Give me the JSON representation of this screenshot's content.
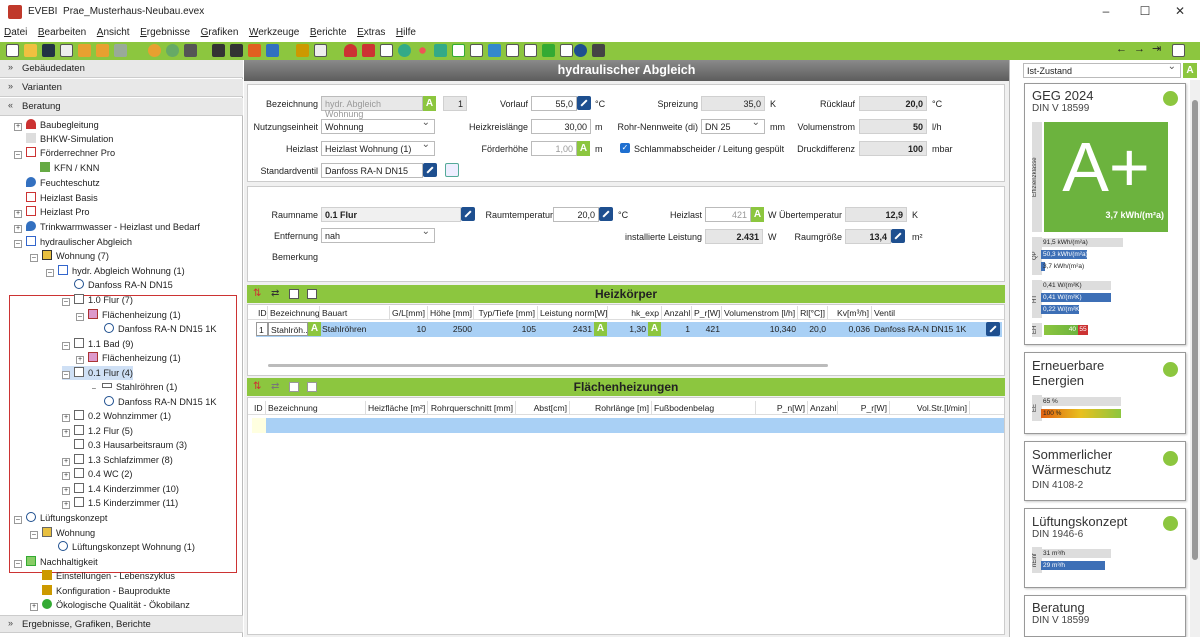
{
  "window": {
    "app": "EVEBI",
    "file": "Prae_Musterhaus-Neubau.evex",
    "minimize": "–",
    "maximize": "☐",
    "close": "✕"
  },
  "menu": [
    "Datei",
    "Bearbeiten",
    "Ansicht",
    "Ergebnisse",
    "Grafiken",
    "Werkzeuge",
    "Berichte",
    "Extras",
    "Hilfe"
  ],
  "left": {
    "sections": [
      "Gebäudedaten",
      "Varianten",
      "Beratung"
    ],
    "bottom_section": "Ergebnisse, Grafiken, Berichte",
    "tree": [
      "Baubegleitung",
      "BHKW-Simulation",
      "Förderrechner Pro",
      "KFN / KNN",
      "Feuchteschutz",
      "Heizlast Basis",
      "Heizlast Pro",
      "Trinkwarmwasser - Heizlast und Bedarf",
      "hydraulischer Abgleich",
      "Wohnung (7)",
      "hydr. Abgleich Wohnung (1)",
      "Danfoss RA-N DN15",
      "1.0 Flur (7)",
      "Flächenheizung (1)",
      "Danfoss RA-N DN15 1K",
      "1.1 Bad (9)",
      "Flächenheizung (1)",
      "0.1 Flur (4)",
      "Stahlröhren (1)",
      "Danfoss RA-N DN15 1K",
      "0.2 Wohnzimmer (1)",
      "1.2 Flur (5)",
      "0.3 Hausarbeitsraum (3)",
      "1.3 Schlafzimmer (8)",
      "0.4 WC (2)",
      "1.4 Kinderzimmer (10)",
      "1.5 Kinderzimmer (11)",
      "Lüftungskonzept",
      "Wohnung",
      "Lüftungskonzept Wohnung (1)",
      "Nachhaltigkeit",
      "Einstellungen - Lebenszyklus",
      "Konfiguration - Bauprodukte",
      "Ökologische Qualität - Ökobilanz"
    ]
  },
  "center": {
    "title": "hydraulischer Abgleich",
    "top": {
      "bezeichnung_label": "Bezeichnung",
      "bezeichnung_value": "hydr. Abgleich Wohnung",
      "bez_num": "1",
      "nutzung_label": "Nutzungseinheit",
      "nutzung_value": "Wohnung",
      "heizlast_label": "Heizlast",
      "heizlast_value": "Heizlast Wohnung (1)",
      "ventil_label": "Standardventil",
      "ventil_value": "Danfoss RA-N DN15",
      "vorlauf_label": "Vorlauf",
      "vorlauf_value": "55,0",
      "vorlauf_unit": "°C",
      "hkl_label": "Heizkreislänge",
      "hkl_value": "30,00",
      "hkl_unit": "m",
      "fh_label": "Förderhöhe",
      "fh_value": "1,00",
      "fh_unit": "m",
      "spreizung_label": "Spreizung",
      "spreizung_value": "35,0",
      "spreizung_unit": "K",
      "rohr_label": "Rohr-Nennweite (di)",
      "rohr_value": "DN 25",
      "rohr_unit": "mm",
      "schlamm_label": "Schlammabscheider / Leitung gespült",
      "ruecklauf_label": "Rücklauf",
      "ruecklauf_value": "20,0",
      "ruecklauf_unit": "°C",
      "vstrom_label": "Volumenstrom",
      "vstrom_value": "50",
      "vstrom_unit": "l/h",
      "druck_label": "Druckdifferenz",
      "druck_value": "100",
      "druck_unit": "mbar"
    },
    "room": {
      "raumname_label": "Raumname",
      "raumname_value": "0.1 Flur",
      "entfernung_label": "Entfernung",
      "entfernung_value": "nah",
      "bemerkung_label": "Bemerkung",
      "raumtemp_label": "Raumtemperatur",
      "raumtemp_value": "20,0",
      "raumtemp_unit": "°C",
      "heizlast_label": "Heizlast",
      "heizlast_value": "421",
      "heizlast_unit": "W",
      "uebertemp_label": "Übertemperatur",
      "uebertemp_value": "12,9",
      "uebertemp_unit": "K",
      "instl_label": "installierte Leistung",
      "instl_value": "2.431",
      "instl_unit": "W",
      "raumgr_label": "Raumgröße",
      "raumgr_value": "13,4",
      "raumgr_unit": "m²"
    },
    "heizkoerper": {
      "title": "Heizkörper",
      "columns": [
        "ID",
        "Bezeichnung",
        "Bauart",
        "G/L[mm]",
        "Höhe [mm]",
        "Typ/Tiefe [mm]",
        "Leistung norm[W]",
        "hk_exp",
        "Anzahl",
        "P_r[W]",
        "Volumenstrom [l/h]",
        "Rl[°C]]",
        "Kv[m³/h]",
        "Ventil"
      ],
      "row": [
        "1",
        "Stahlröh...",
        "Stahlröhren",
        "10",
        "2500",
        "105",
        "2431",
        "1,30",
        "1",
        "421",
        "10,340",
        "20,0",
        "0,036",
        "Danfoss RA-N DN15 1K"
      ]
    },
    "flaechen": {
      "title": "Flächenheizungen",
      "columns": [
        "ID",
        "Bezeichnung",
        "Heizfläche [m²]",
        "Rohrquerschnitt [mm]",
        "Abst[cm]",
        "Rohrlänge [m]",
        "Fußbodenbelag",
        "P_n[W]",
        "Anzahl",
        "P_r[W]",
        "Vol.Str.[l/min]"
      ]
    }
  },
  "right": {
    "dropdown": "Ist-Zustand",
    "geg": {
      "title": "GEG 2024",
      "sub": "DIN V 18599",
      "grade": "A+",
      "value": "3,7 kWh/(m²a)",
      "side": "Effizienzklasse",
      "qp": [
        "91,5 kWh/(m²a)",
        "50,3 kWh/(m²a)",
        "3,7 kWh/(m²a)"
      ],
      "qp_label": "QP",
      "ht": [
        "0,41 W/(m²K)",
        "0,41 W/(m²K)",
        "0,22 W/(m²K)"
      ],
      "ht_label": "HT",
      "eh": [
        "40",
        "55"
      ],
      "eh_label": "EH"
    },
    "ee": {
      "title": "Erneuerbare Energien",
      "bars": [
        "65 %",
        "100 %"
      ],
      "label": "EE"
    },
    "sw": {
      "title": "Sommerlicher Wärmeschutz",
      "sub": "DIN 4108-2"
    },
    "lk": {
      "title": "Lüftungskonzept",
      "sub": "DIN 1946-6",
      "bars": [
        "31 m³/h",
        "29 m³/h"
      ],
      "label": "nEinf"
    },
    "ber": {
      "title": "Beratung",
      "sub": "DIN V 18599"
    }
  }
}
